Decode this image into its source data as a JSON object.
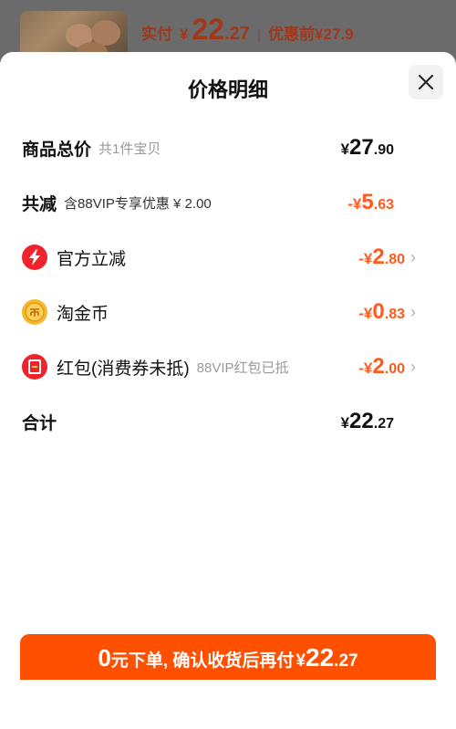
{
  "background": {
    "pay_label": "实付",
    "currency": "¥",
    "pay_int": "22",
    "pay_dec": ".27",
    "separator": "|",
    "original_label": "优惠前",
    "original_price": "¥27.9"
  },
  "sheet": {
    "title": "价格明细",
    "rows": [
      {
        "label": "商品总价",
        "sub": "共1件宝贝",
        "currency": "¥",
        "int": "27",
        "dec": ".90"
      },
      {
        "label": "共减",
        "sub": "含88VIP专享优惠 ¥ 2.00",
        "currency": "-¥",
        "int": "5",
        "dec": ".63"
      },
      {
        "label": "官方立减",
        "sub": "",
        "currency": "-¥",
        "int": "2",
        "dec": ".80",
        "icon": "lightning-icon"
      },
      {
        "label": "淘金币",
        "sub": "",
        "currency": "-¥",
        "int": "0",
        "dec": ".83",
        "icon": "coin-icon"
      },
      {
        "label": "红包(消费券未抵)",
        "sub": "88VIP红包已抵",
        "currency": "-¥",
        "int": "2",
        "dec": ".00",
        "icon": "red-envelope-icon"
      },
      {
        "label": "合计",
        "sub": "",
        "currency": "¥",
        "int": "22",
        "dec": ".27"
      }
    ]
  },
  "cta": {
    "zero": "0",
    "text": "元下单, 确认收货后再付",
    "currency": "¥",
    "int": "22",
    "dec": ".27"
  },
  "colors": {
    "accent": "#ff5000",
    "discount": "#ff5a1f",
    "bolt_red": "#f0232d",
    "coin_yellow": "#f5b82e"
  }
}
